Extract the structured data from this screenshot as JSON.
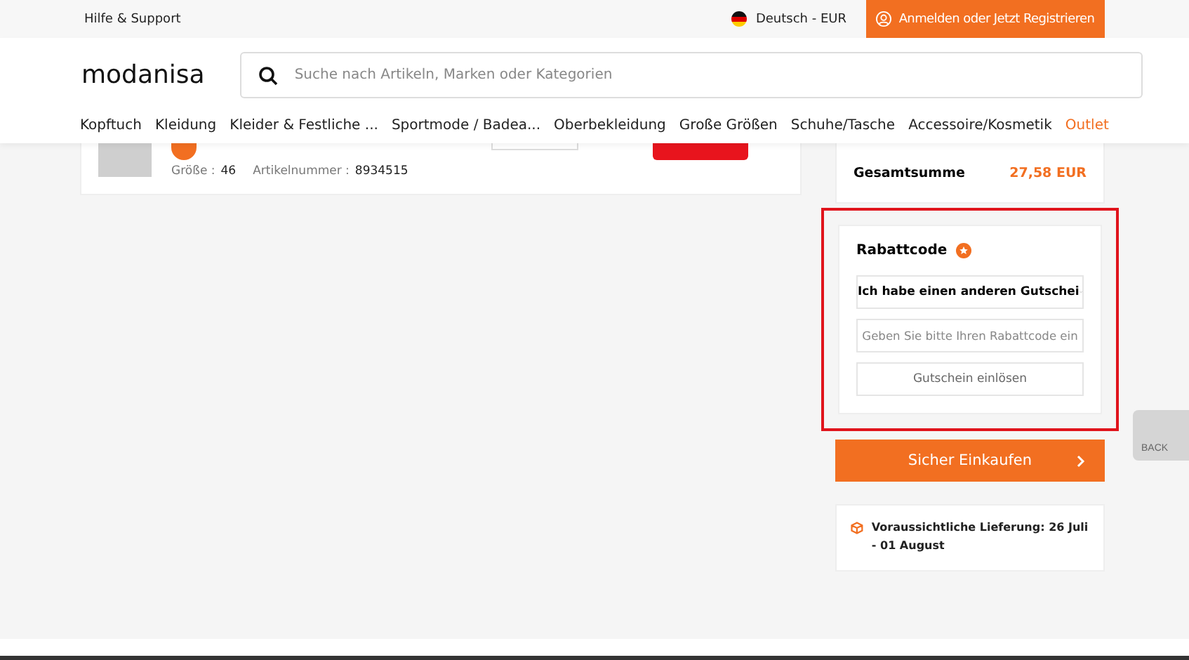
{
  "top_bar": {
    "help": "Hilfe & Support",
    "language": "Deutsch - EUR",
    "login": "Anmelden oder Jetzt Registrieren"
  },
  "header": {
    "logo": "modanisa",
    "search": {
      "placeholder": "Suche nach Artikeln, Marken oder Kategorien"
    }
  },
  "nav": [
    {
      "label": "Kopftuch",
      "highlight": false
    },
    {
      "label": "Kleidung",
      "highlight": false
    },
    {
      "label": "Kleider & Festliche ...",
      "highlight": false
    },
    {
      "label": "Sportmode / Badea...",
      "highlight": false
    },
    {
      "label": "Oberbekleidung",
      "highlight": false
    },
    {
      "label": "Große Größen",
      "highlight": false
    },
    {
      "label": "Schuhe/Tasche",
      "highlight": false
    },
    {
      "label": "Accessoire/Kosmetik",
      "highlight": false
    },
    {
      "label": "Outlet",
      "highlight": true
    }
  ],
  "cart_item": {
    "size_label": "Größe :",
    "size": "46",
    "article_label": "Artikelnummer :",
    "article": "8934515"
  },
  "summary": {
    "total_label": "Gesamtsumme",
    "total": "27,58 EUR"
  },
  "coupon": {
    "title": "Rabattcode",
    "select": "Ich habe einen anderen Gutschei",
    "input": {
      "placeholder": "Geben Sie bitte Ihren Rabattcode ein"
    },
    "redeem": "Gutschein einlösen",
    "outlined": true
  },
  "checkout": "Sicher Einkaufen",
  "delivery": "Voraussichtliche Lieferung: 26 Juli - 01 August",
  "back_to_top": "BACK"
}
